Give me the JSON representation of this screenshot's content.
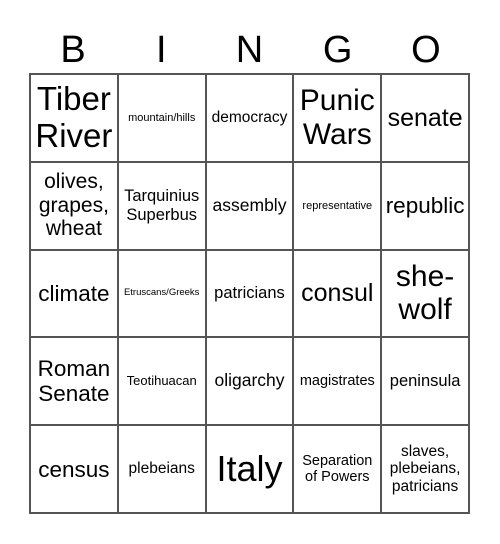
{
  "header": {
    "letters": [
      "B",
      "I",
      "N",
      "G",
      "O"
    ]
  },
  "grid": {
    "rows": [
      [
        "Tiber River",
        "mountain/hills",
        "democracy",
        "Punic Wars",
        "senate"
      ],
      [
        "olives, grapes, wheat",
        "Tarquinius Superbus",
        "assembly",
        "representative",
        "republic"
      ],
      [
        "climate",
        "Etruscans/Greeks",
        "patricians",
        "consul",
        "she-wolf"
      ],
      [
        "Roman Senate",
        "Teotihuacan",
        "oligarchy",
        "magistrates",
        "peninsula"
      ],
      [
        "census",
        "plebeians",
        "Italy",
        "Separation of Powers",
        "slaves, plebeians, patricians"
      ]
    ]
  },
  "colors": {
    "border": "#555555",
    "text": "#000000",
    "background": "#ffffff"
  }
}
